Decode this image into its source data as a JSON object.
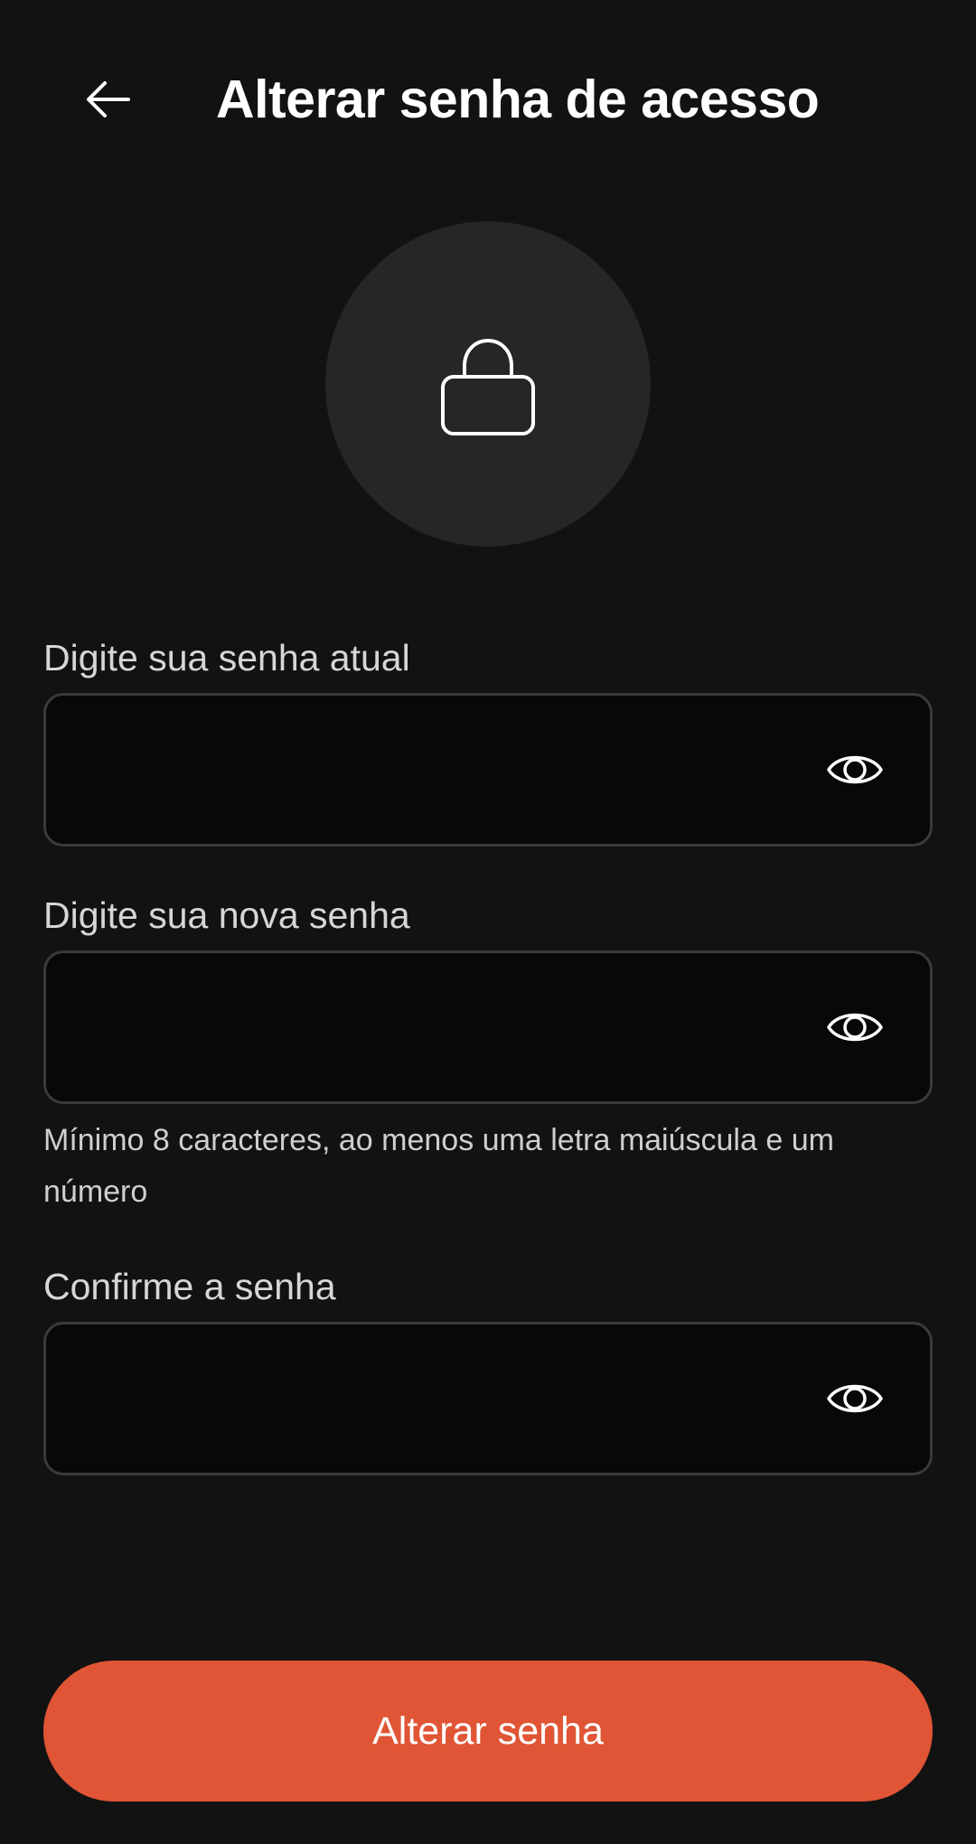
{
  "header": {
    "title": "Alterar senha de acesso",
    "back_icon": "arrow-left-icon"
  },
  "hero": {
    "icon": "lock-icon"
  },
  "form": {
    "current_password": {
      "label": "Digite sua senha atual",
      "value": "",
      "icon": "eye-icon"
    },
    "new_password": {
      "label": "Digite sua nova senha",
      "value": "",
      "icon": "eye-icon",
      "hint": "Mínimo 8 caracteres, ao menos uma letra maiúscula e um número"
    },
    "confirm_password": {
      "label": "Confirme a senha",
      "value": "",
      "icon": "eye-icon"
    }
  },
  "submit": {
    "label": "Alterar senha"
  },
  "colors": {
    "background": "#121212",
    "accent": "#e05535",
    "field_background": "#080808",
    "field_border": "#3a3a3a",
    "circle": "#262626"
  }
}
